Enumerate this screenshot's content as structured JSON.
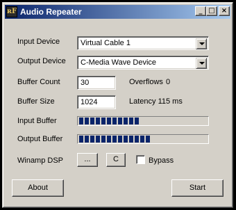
{
  "window": {
    "title": "Audio Repeater",
    "icon_text": "ʀF",
    "minimize_glyph": "_",
    "maximize_glyph": "□",
    "close_glyph": "×"
  },
  "input_device": {
    "label": "Input Device",
    "value": "Virtual Cable 1"
  },
  "output_device": {
    "label": "Output Device",
    "value": "C-Media Wave Device"
  },
  "buffer_count": {
    "label": "Buffer Count",
    "value": "30"
  },
  "overflows": {
    "label": "Overflows",
    "value": "0"
  },
  "buffer_size": {
    "label": "Buffer Size",
    "value": "1024"
  },
  "latency": {
    "label": "Latency",
    "value": "115 ms"
  },
  "input_buffer": {
    "label": "Input Buffer",
    "level_percent": 46
  },
  "output_buffer": {
    "label": "Output Buffer",
    "level_percent": 58
  },
  "winamp_dsp": {
    "label": "Winamp DSP",
    "config_button": "...",
    "c_button": "C"
  },
  "bypass": {
    "label": "Bypass",
    "checked": false
  },
  "buttons": {
    "about": "About",
    "start": "Start"
  },
  "colors": {
    "title_start": "#0a246a",
    "title_end": "#a6caf0",
    "progress": "#0a246a",
    "face": "#d4d0c8"
  }
}
